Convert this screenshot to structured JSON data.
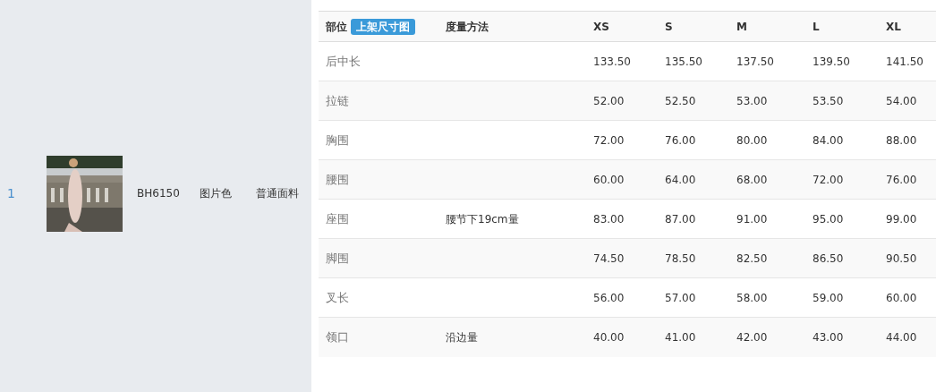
{
  "product": {
    "index": "1",
    "code": "BH6150",
    "color_name": "图片色",
    "fabric": "普通面料"
  },
  "size_table": {
    "columns": [
      "部位",
      "度量方法",
      "XS",
      "S",
      "M",
      "L",
      "XL"
    ],
    "header_button": "上架尺寸图",
    "rows": [
      {
        "part": "后中长",
        "method": "",
        "values": [
          "133.50",
          "135.50",
          "137.50",
          "139.50",
          "141.50"
        ]
      },
      {
        "part": "拉链",
        "method": "",
        "values": [
          "52.00",
          "52.50",
          "53.00",
          "53.50",
          "54.00"
        ]
      },
      {
        "part": "胸围",
        "method": "",
        "values": [
          "72.00",
          "76.00",
          "80.00",
          "84.00",
          "88.00"
        ]
      },
      {
        "part": "腰围",
        "method": "",
        "values": [
          "60.00",
          "64.00",
          "68.00",
          "72.00",
          "76.00"
        ]
      },
      {
        "part": "座围",
        "method": "腰节下19cm量",
        "values": [
          "83.00",
          "87.00",
          "91.00",
          "95.00",
          "99.00"
        ]
      },
      {
        "part": "脚围",
        "method": "",
        "values": [
          "74.50",
          "78.50",
          "82.50",
          "86.50",
          "90.50"
        ]
      },
      {
        "part": "叉长",
        "method": "",
        "values": [
          "56.00",
          "57.00",
          "58.00",
          "59.00",
          "60.00"
        ]
      },
      {
        "part": "领口",
        "method": "沿边量",
        "values": [
          "40.00",
          "41.00",
          "42.00",
          "43.00",
          "44.00"
        ]
      }
    ]
  }
}
